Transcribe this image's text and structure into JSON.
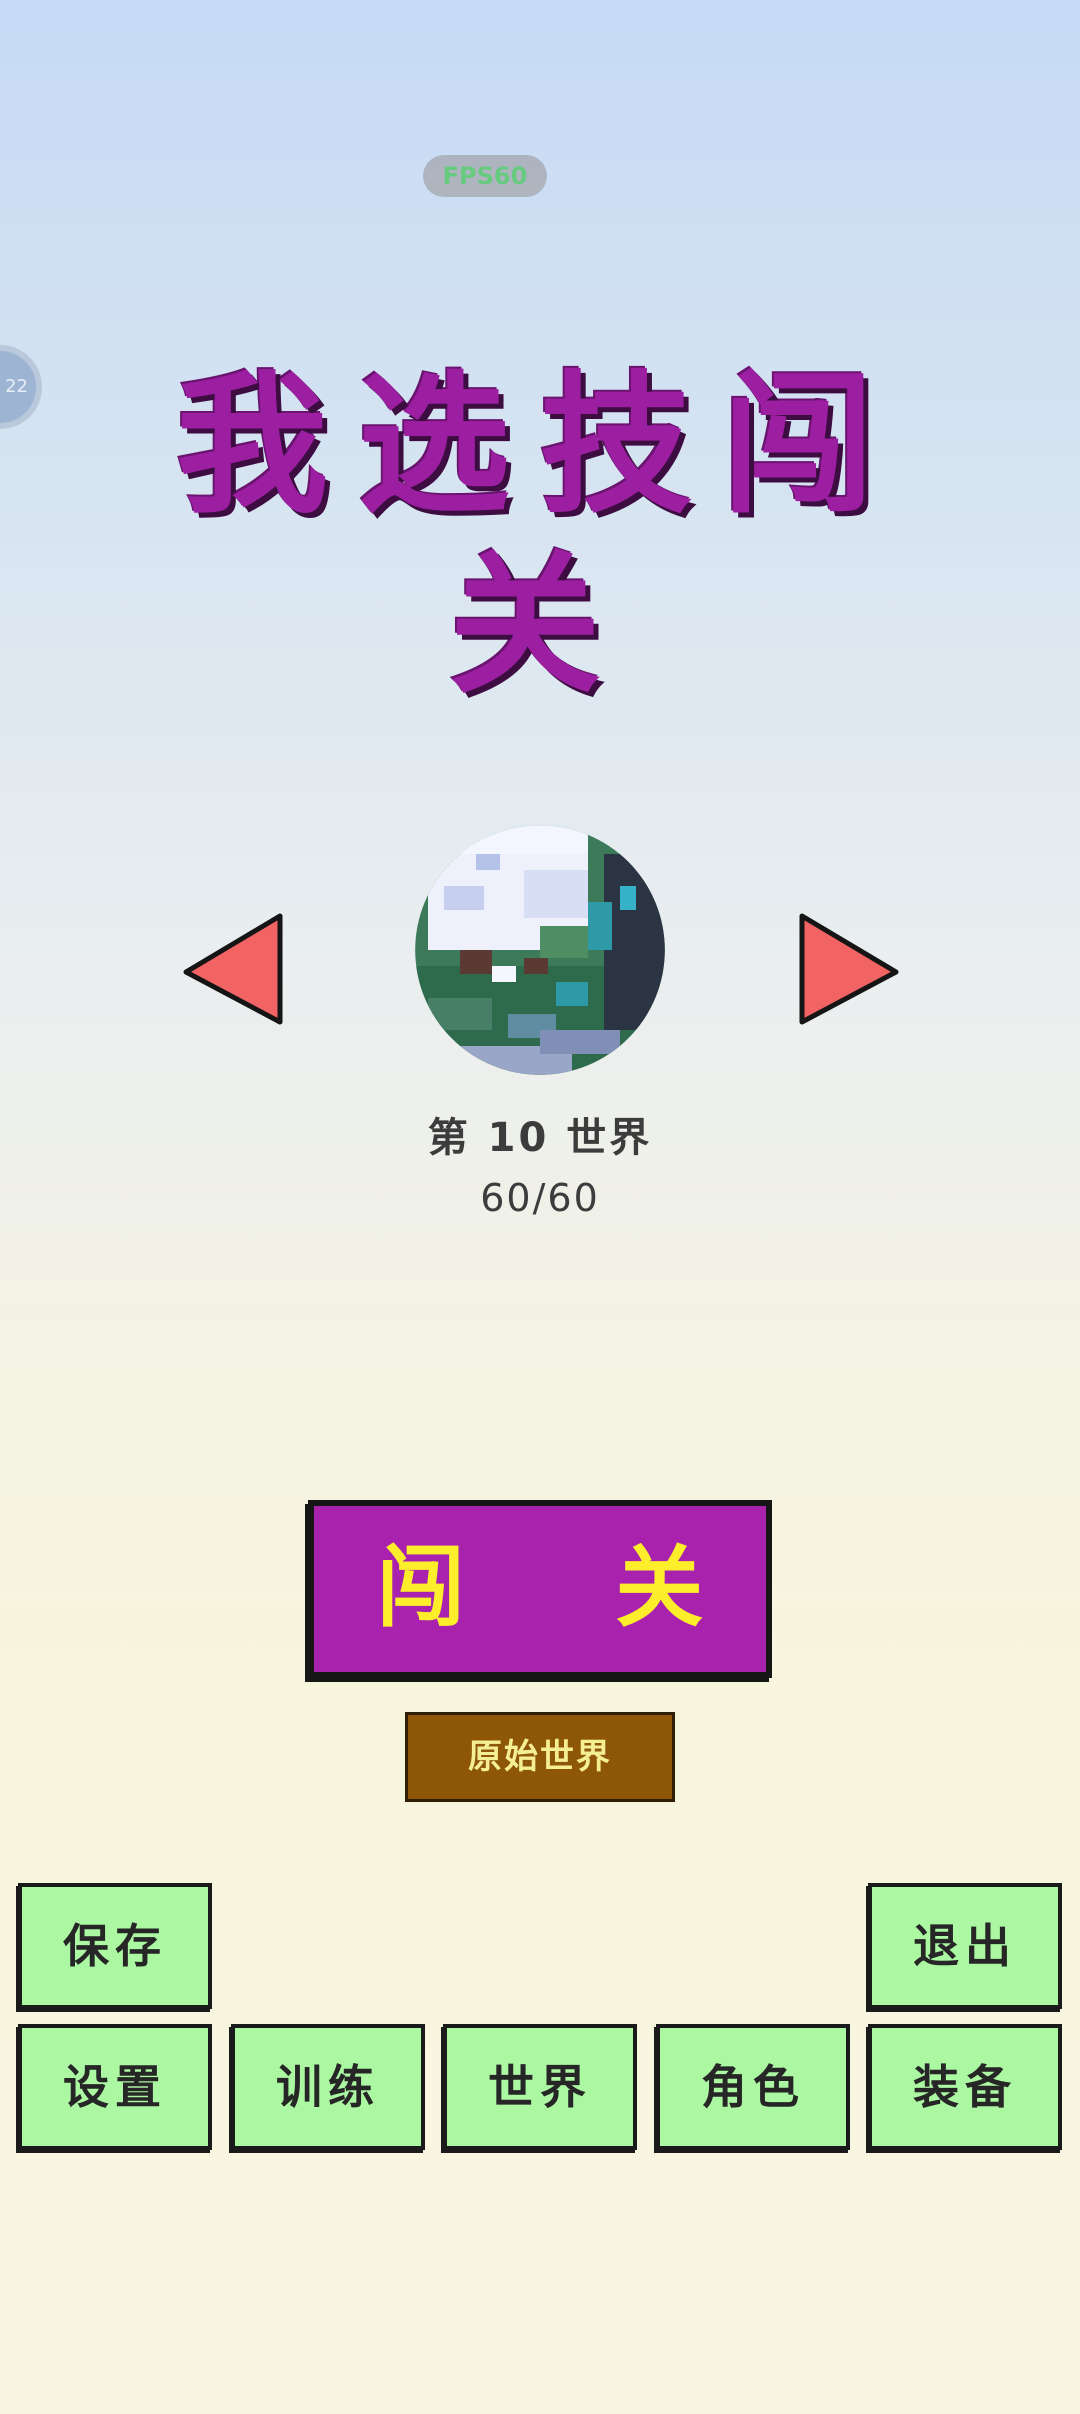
{
  "hud": {
    "fps": "FPS60",
    "side_bubble": "22"
  },
  "title": "我选技闯关",
  "world": {
    "label": "第 10 世界",
    "progress": "60/60",
    "planet_icon": "pixel-earth-icon"
  },
  "buttons": {
    "play": "闯 关",
    "world_type": "原始世界"
  },
  "menu": {
    "save": "保存",
    "exit": "退出",
    "settings": "设置",
    "training": "训练",
    "world": "世界",
    "character": "角色",
    "equipment": "装备"
  },
  "colors": {
    "title": "#9c1fa2",
    "arrow": "#f26464",
    "play_bg": "#a922ae",
    "play_text": "#fcee2a",
    "world_type_bg": "#8e5708",
    "menu_bg": "#abf7a2"
  }
}
